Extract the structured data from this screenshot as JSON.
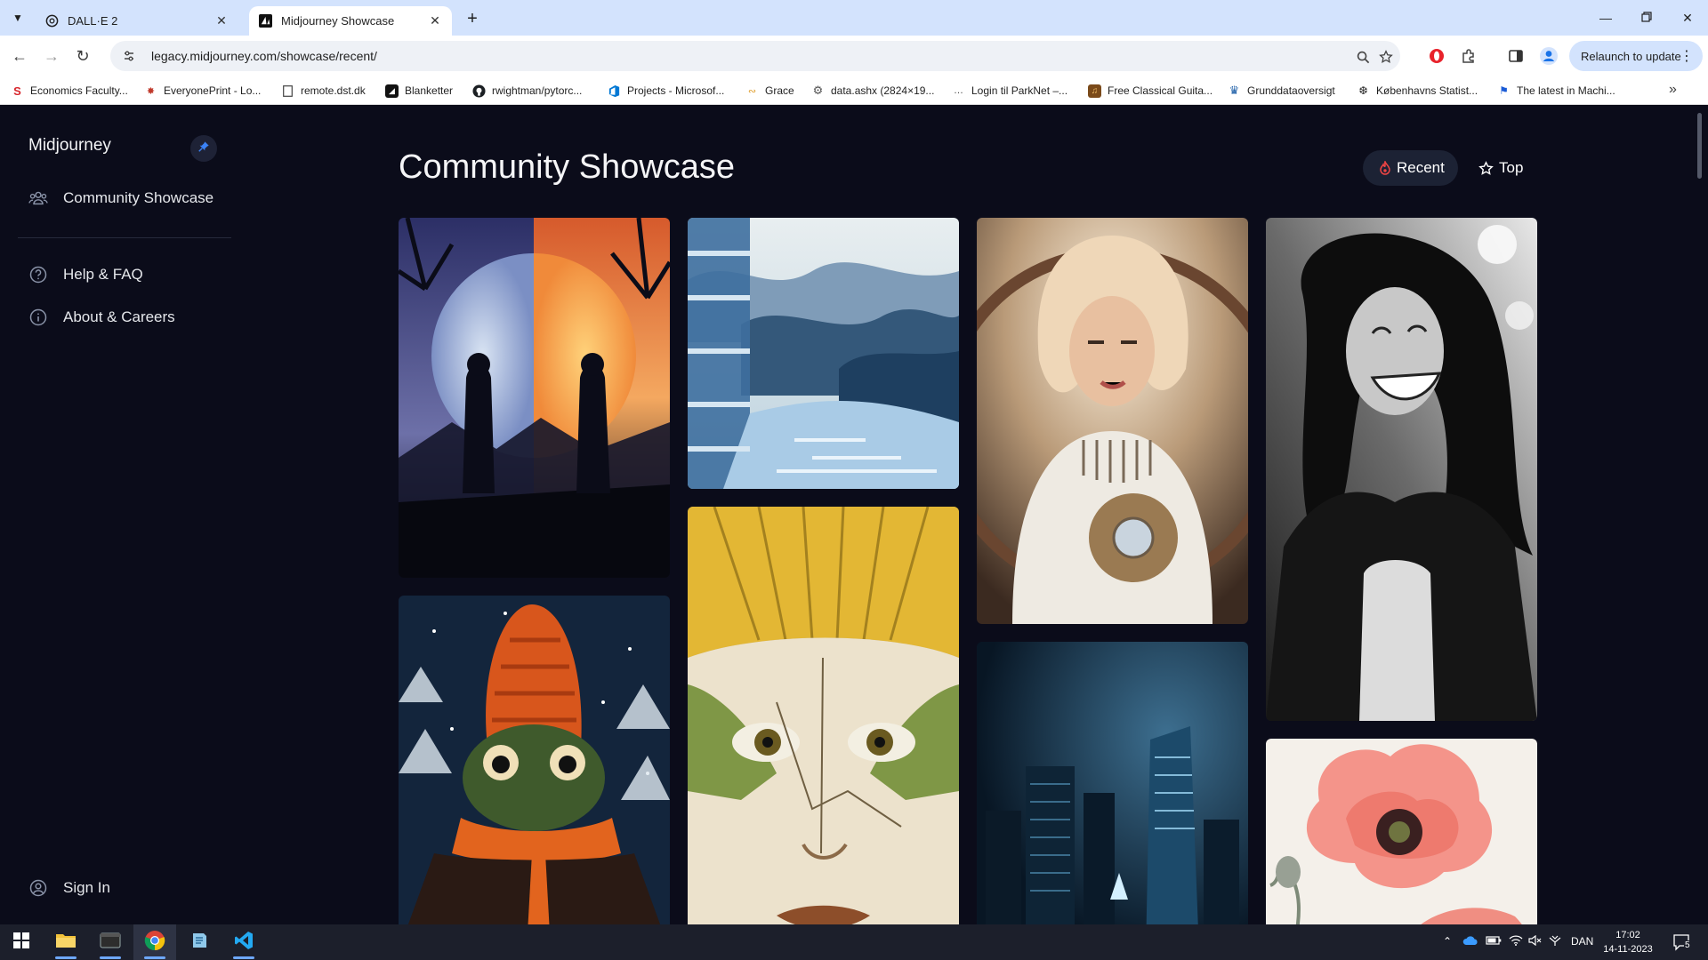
{
  "browser": {
    "tabs": [
      {
        "title": "DALL·E 2",
        "active": false
      },
      {
        "title": "Midjourney Showcase",
        "active": true
      }
    ],
    "url": "legacy.midjourney.com/showcase/recent/",
    "relaunch_label": "Relaunch to update",
    "bookmarks": [
      {
        "label": "Economics Faculty...",
        "icon": "s-logo-icon"
      },
      {
        "label": "EveryonePrint - Lo...",
        "icon": "everyoneprint-icon"
      },
      {
        "label": "remote.dst.dk",
        "icon": "document-icon"
      },
      {
        "label": "Blanketter",
        "icon": "blanketter-icon"
      },
      {
        "label": "rwightman/pytorc...",
        "icon": "github-icon"
      },
      {
        "label": "Projects - Microsof...",
        "icon": "azure-devops-icon"
      },
      {
        "label": "Grace",
        "icon": "grace-icon"
      },
      {
        "label": "data.ashx (2824×19...",
        "icon": "gear-icon"
      },
      {
        "label": "Login til ParkNet –...",
        "icon": "parknet-icon"
      },
      {
        "label": "Free Classical Guita...",
        "icon": "guitar-icon"
      },
      {
        "label": "Grunddataoversigt",
        "icon": "crown-icon"
      },
      {
        "label": "Københavns Statist...",
        "icon": "statistics-icon"
      },
      {
        "label": "The latest in Machi...",
        "icon": "flag-icon"
      }
    ]
  },
  "sidebar": {
    "brand": "Midjourney",
    "items": [
      {
        "label": "Community Showcase",
        "icon": "people-icon"
      },
      {
        "label": "Help & FAQ",
        "icon": "question-circle-icon"
      },
      {
        "label": "About & Careers",
        "icon": "info-circle-icon"
      }
    ],
    "sign_in": "Sign In"
  },
  "main": {
    "title": "Community Showcase",
    "filters": [
      {
        "label": "Recent",
        "active": true,
        "icon": "flame-icon"
      },
      {
        "label": "Top",
        "active": false,
        "icon": "star-icon"
      }
    ],
    "images": [
      {
        "subject": "moon-sun-silhouettes"
      },
      {
        "subject": "frog-in-knit-hat"
      },
      {
        "subject": "glitch-landscape"
      },
      {
        "subject": "cracked-face"
      },
      {
        "subject": "blonde-woman-portrait"
      },
      {
        "subject": "night-skyscrapers"
      },
      {
        "subject": "laughing-woman-bw"
      },
      {
        "subject": "red-poppy"
      }
    ]
  },
  "taskbar": {
    "language": "DAN",
    "time": "17:02",
    "date": "14-11-2023",
    "notifications": "5"
  },
  "colors": {
    "page_bg": "#0b0c1a",
    "tab_strip": "#d3e3fd",
    "active_pill": "#1c2234",
    "accent_red": "#ef4444"
  }
}
